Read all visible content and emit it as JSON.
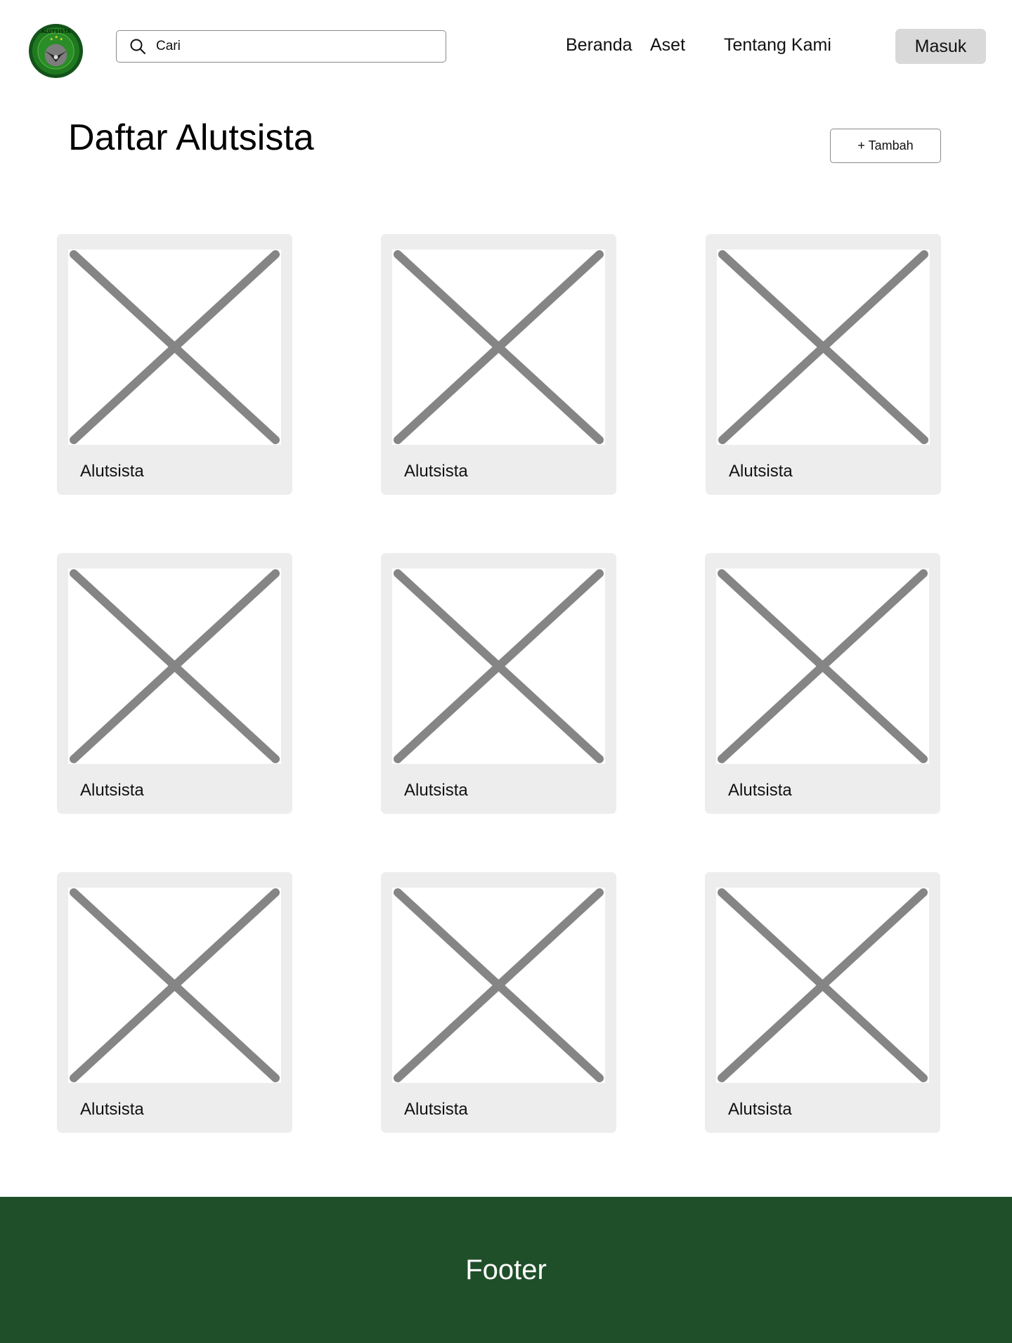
{
  "header": {
    "logo_text": "ALUTSISTA",
    "logo_icon": "emblem-logo",
    "search": {
      "placeholder": "Cari",
      "icon": "search-icon"
    },
    "nav": [
      {
        "label": "Beranda"
      },
      {
        "label": "Aset"
      },
      {
        "label": "Tentang Kami"
      }
    ],
    "login_label": "Masuk"
  },
  "main": {
    "title": "Daftar Alutsista",
    "add_label": "+ Tambah",
    "cards": [
      {
        "label": "Alutsista",
        "image_icon": "image-placeholder-icon"
      },
      {
        "label": "Alutsista",
        "image_icon": "image-placeholder-icon"
      },
      {
        "label": "Alutsista",
        "image_icon": "image-placeholder-icon"
      },
      {
        "label": "Alutsista",
        "image_icon": "image-placeholder-icon"
      },
      {
        "label": "Alutsista",
        "image_icon": "image-placeholder-icon"
      },
      {
        "label": "Alutsista",
        "image_icon": "image-placeholder-icon"
      },
      {
        "label": "Alutsista",
        "image_icon": "image-placeholder-icon"
      },
      {
        "label": "Alutsista",
        "image_icon": "image-placeholder-icon"
      },
      {
        "label": "Alutsista",
        "image_icon": "image-placeholder-icon"
      }
    ]
  },
  "footer": {
    "text": "Footer"
  },
  "colors": {
    "footer_bg": "#1f4f29",
    "card_bg": "#ededed",
    "button_bg": "#d9d9d9",
    "placeholder_stroke": "#858585",
    "logo_green": "#1f6b1c"
  }
}
